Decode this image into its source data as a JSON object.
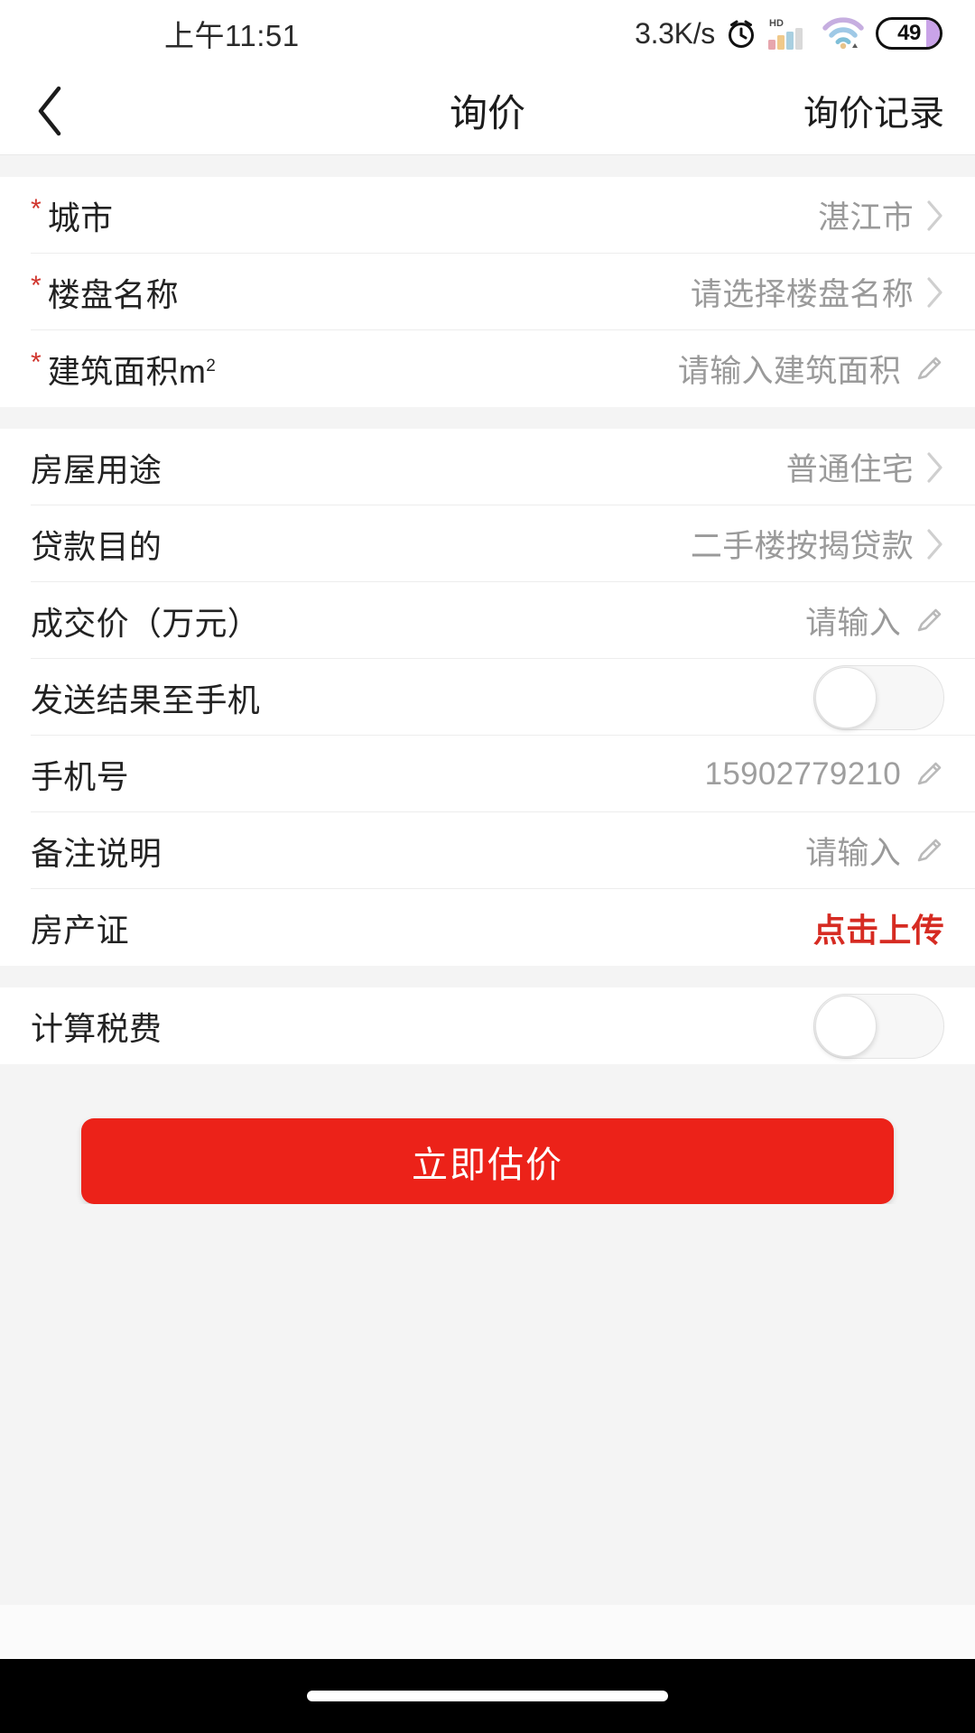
{
  "status_bar": {
    "time": "上午11:51",
    "net_speed": "3.3K/s",
    "alarm_icon": "alarm-clock-icon",
    "hd_label": "HD",
    "signal_icon": "signal-bars-icon",
    "wifi_icon": "wifi-icon",
    "battery_level": "49"
  },
  "nav": {
    "back_icon": "chevron-left-icon",
    "title": "询价",
    "action_label": "询价记录"
  },
  "colors": {
    "accent_red": "#ec2219",
    "required_star": "#d0342c",
    "upload_red": "#d62b22",
    "page_bg": "#f4f4f4",
    "card_bg": "#ffffff",
    "label_text": "#222222",
    "value_text": "#9a9a9a"
  },
  "sections": [
    {
      "name": "property-basics",
      "rows": [
        {
          "name": "city",
          "required": true,
          "star": "*",
          "label": "城市",
          "value": "湛江市",
          "value_kind": "selected",
          "control": "chevron"
        },
        {
          "name": "estate-name",
          "required": true,
          "star": "*",
          "label": "楼盘名称",
          "value": "请选择楼盘名称",
          "value_kind": "placeholder",
          "control": "chevron"
        },
        {
          "name": "building-area",
          "required": true,
          "star": "*",
          "label": "建筑面积m",
          "label_sup": "2",
          "value": "请输入建筑面积",
          "value_kind": "placeholder",
          "control": "pencil"
        }
      ]
    },
    {
      "name": "loan-details",
      "rows": [
        {
          "name": "house-usage",
          "required": false,
          "label": "房屋用途",
          "value": "普通住宅",
          "value_kind": "selected",
          "control": "chevron"
        },
        {
          "name": "loan-purpose",
          "required": false,
          "label": "贷款目的",
          "value": "二手楼按揭贷款",
          "value_kind": "selected",
          "control": "chevron"
        },
        {
          "name": "deal-price",
          "required": false,
          "label": "成交价（万元）",
          "value": "请输入",
          "value_kind": "placeholder",
          "control": "pencil"
        },
        {
          "name": "send-result-to-phone",
          "required": false,
          "label": "发送结果至手机",
          "value": "",
          "value_kind": "none",
          "control": "toggle",
          "toggle_on": false
        },
        {
          "name": "phone-number",
          "required": false,
          "label": "手机号",
          "value": "15902779210",
          "value_kind": "filled",
          "control": "pencil"
        },
        {
          "name": "remark",
          "required": false,
          "label": "备注说明",
          "value": "请输入",
          "value_kind": "placeholder",
          "control": "pencil"
        },
        {
          "name": "property-certificate",
          "required": false,
          "label": "房产证",
          "value": "点击上传",
          "value_kind": "accent",
          "control": "none"
        }
      ]
    },
    {
      "name": "tax-section",
      "rows": [
        {
          "name": "calculate-tax",
          "required": false,
          "label": "计算税费",
          "value": "",
          "value_kind": "none",
          "control": "toggle",
          "toggle_on": false
        }
      ]
    }
  ],
  "cta": {
    "label": "立即估价"
  },
  "home_indicator": "home-indicator-pill"
}
